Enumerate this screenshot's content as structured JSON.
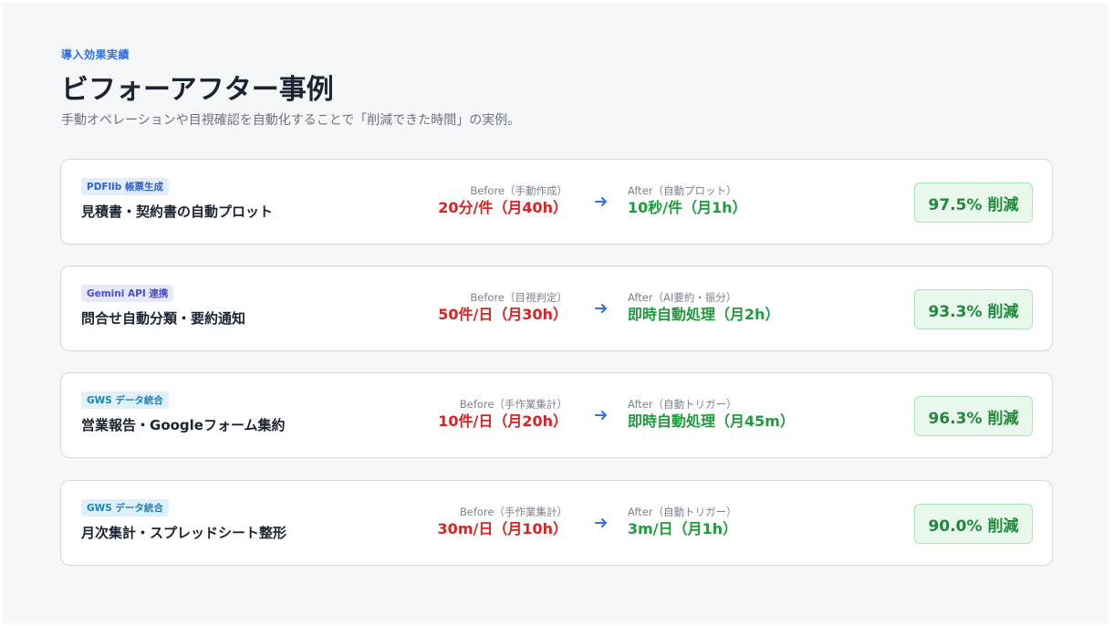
{
  "header": {
    "eyebrow": "導入効果実績",
    "title": "ビフォーアフター事例",
    "subtitle": "手動オペレーションや目視確認を自動化することで「削減できた時間」の実例。"
  },
  "cases": [
    {
      "tag": "PDFlib 帳票生成",
      "title": "見積書・契約書の自動プロット",
      "before_label": "Before（手動作成）",
      "before_value": "20分/件（月40h）",
      "after_label": "After（自動プロット）",
      "after_value": "10秒/件（月1h）",
      "reduction": "97.5% 削減"
    },
    {
      "tag": "Gemini API 連携",
      "title": "問合せ自動分類・要約通知",
      "before_label": "Before（目視判定）",
      "before_value": "50件/日（月30h）",
      "after_label": "After（AI要約・振分）",
      "after_value": "即時自動処理（月2h）",
      "reduction": "93.3% 削減"
    },
    {
      "tag": "GWS データ統合",
      "title": "営業報告・Googleフォーム集約",
      "before_label": "Before（手作業集計）",
      "before_value": "10件/日（月20h）",
      "after_label": "After（自動トリガー）",
      "after_value": "即時自動処理（月45m）",
      "reduction": "96.3% 削減"
    },
    {
      "tag": "GWS データ統合",
      "title": "月次集計・スプレッドシート整形",
      "before_label": "Before（手作業集計）",
      "before_value": "30m/日（月10h）",
      "after_label": "After（自動トリガー）",
      "after_value": "3m/日（月1h）",
      "reduction": "90.0% 削減"
    }
  ],
  "icons": {
    "arrow": "arrow-right-icon"
  },
  "colors": {
    "accent_blue": "#2f6fe0",
    "before_red": "#d62424",
    "after_green": "#1f9a3c",
    "badge_bg": "#e8f8ec",
    "badge_border": "#a8e2b6"
  }
}
